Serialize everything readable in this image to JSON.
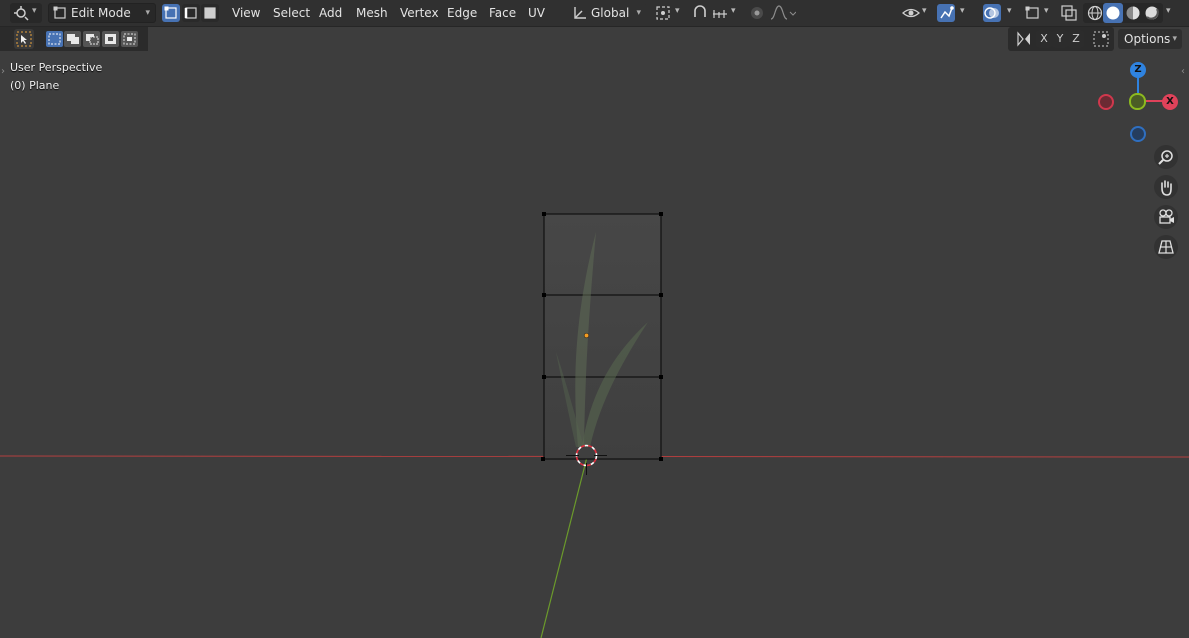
{
  "header": {
    "editor_type_icon": "editor-type-icon",
    "mode_selector": "Edit Mode",
    "select_mode_buttons": [
      "vertex-select-icon",
      "edge-select-icon",
      "face-select-icon"
    ],
    "menus": [
      "View",
      "Select",
      "Add",
      "Mesh",
      "Vertex",
      "Edge",
      "Face",
      "UV"
    ],
    "transform_orientation": "Global",
    "pivot_icon": "pivot-point-icon",
    "snap_icon": "snap-icon",
    "proportional_icon": "proportional-editing-icon",
    "right_icons": [
      "visibility-icon",
      "gizmo-icon",
      "overlay-icon",
      "xray-icon",
      "wireframe-shading-icon",
      "solid-shading-icon",
      "material-shading-icon",
      "rendered-shading-icon"
    ],
    "accent_color": "#4772b3"
  },
  "toolbar": {
    "select_tool_icon": "select-box-icon",
    "selection_modes": [
      "set-new-icon",
      "extend-icon",
      "subtract-icon",
      "invert-icon",
      "intersect-icon"
    ],
    "mirror_axes": [
      "X",
      "Y",
      "Z"
    ],
    "options_label": "Options"
  },
  "viewport": {
    "view_name": "User Perspective",
    "object_name": "(0) Plane",
    "background_color": "#3d3d3d",
    "x_axis_color": "#b33f3f",
    "mesh_rows": 3,
    "mesh_columns": 1
  },
  "navigation_gizmo": {
    "axes": [
      "Z",
      "X"
    ],
    "colors": {
      "x": "#e0425a",
      "y": "#8cba1f",
      "z": "#2f83e0"
    },
    "buttons": [
      "zoom-icon",
      "hand-pan-icon",
      "camera-icon",
      "grid-perspective-icon"
    ]
  }
}
